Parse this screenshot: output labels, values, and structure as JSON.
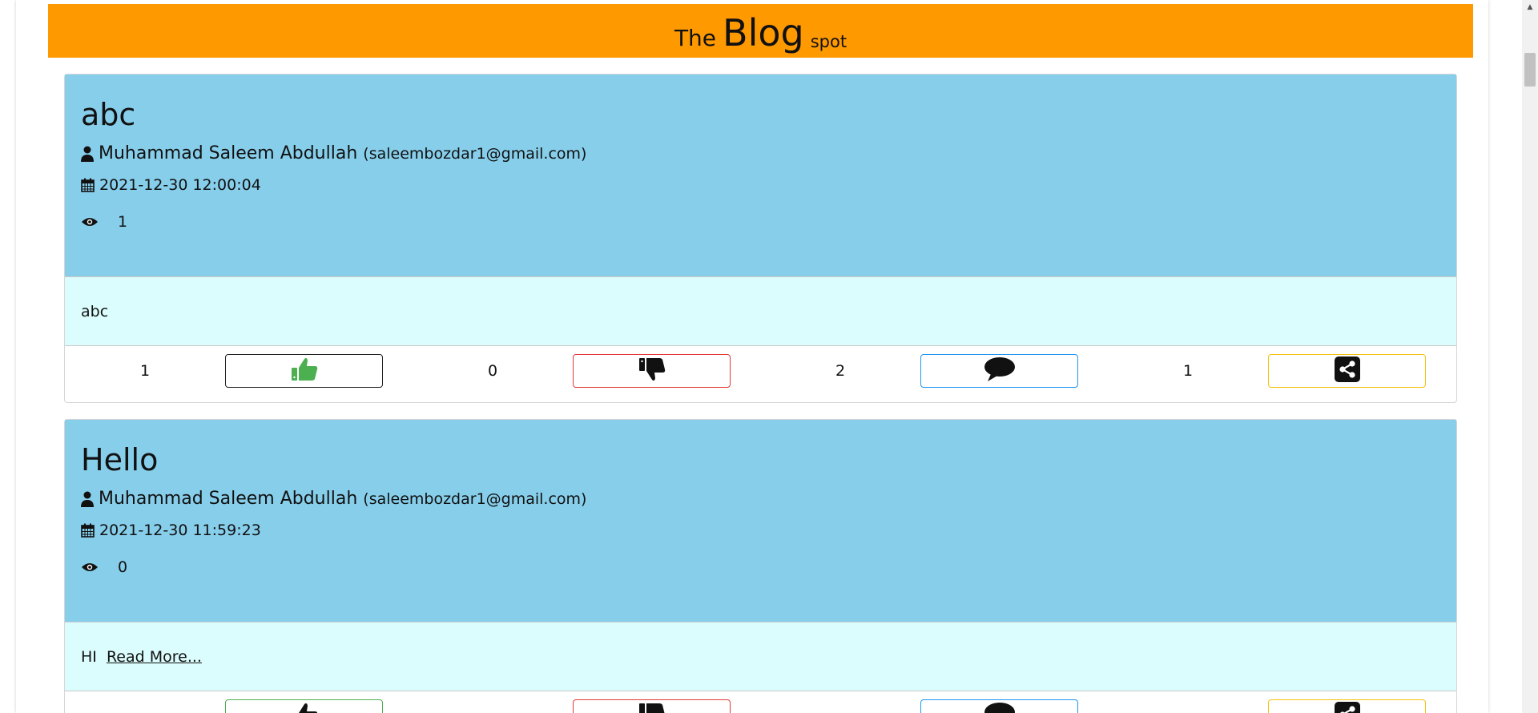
{
  "banner": {
    "word1": "The",
    "word2": "Blog",
    "word3": "spot"
  },
  "icons": {
    "author": "user-icon",
    "date": "calendar-icon",
    "views": "eye-icon",
    "like": "thumbs-up-icon",
    "dislike": "thumbs-down-icon",
    "comment": "comment-icon",
    "share": "share-icon"
  },
  "colors": {
    "banner": "#ff9900",
    "header": "#87ceeb",
    "body": "#dcfdfd",
    "like_icon": "#4caf50"
  },
  "posts": [
    {
      "title": "abc",
      "author": "Muhammad Saleem Abdullah",
      "email": "(saleembozdar1@gmail.com)",
      "date": "2021-12-30 12:00:04",
      "views": "1",
      "content": "abc",
      "read_more": "",
      "likes": "1",
      "dislikes": "0",
      "comments": "2",
      "shares": "1"
    },
    {
      "title": "Hello",
      "author": "Muhammad Saleem Abdullah",
      "email": "(saleembozdar1@gmail.com)",
      "date": "2021-12-30 11:59:23",
      "views": "0",
      "content": "HI",
      "read_more": "Read More...",
      "likes": "",
      "dislikes": "",
      "comments": "",
      "shares": ""
    }
  ]
}
